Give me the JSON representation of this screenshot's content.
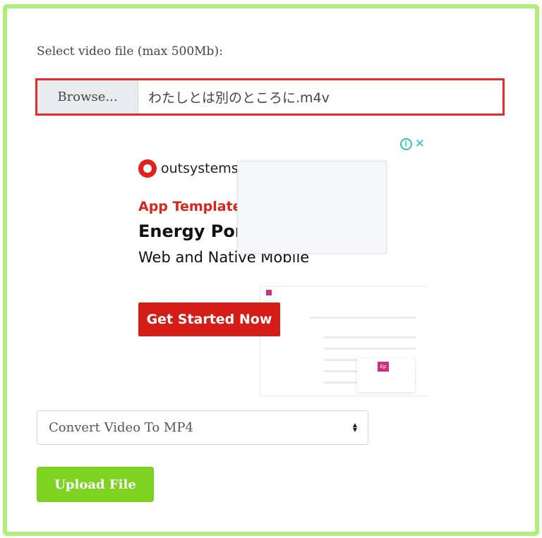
{
  "form": {
    "select_label": "Select video file (max 500Mb):",
    "browse_label": "Browse...",
    "file_name": "わたしとは別のところに.m4v",
    "convert_option": "Convert Video To MP4",
    "upload_label": "Upload File"
  },
  "ad": {
    "brand": "outsystems",
    "eyebrow": "App Template",
    "title": "Energy Portal",
    "subtitle": "Web and Native Mobile",
    "cta": "Get Started Now",
    "info_icon": "info-icon",
    "close_icon": "close-icon",
    "mock_card_mark": "Ep"
  },
  "colors": {
    "frame": "#b2ec7d",
    "highlight": "#e32b2b",
    "upload_button": "#7ed321",
    "ad_accent": "#d41d17",
    "ad_controls": "#29c5c8"
  }
}
